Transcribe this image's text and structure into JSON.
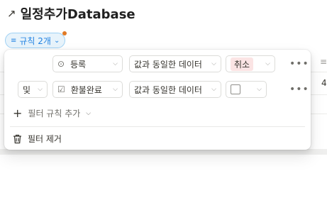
{
  "page": {
    "title": "일정추가Database",
    "title_icon": "arrow-up-right-icon"
  },
  "chip": {
    "label": "규칙 2개",
    "chevron": "⌄"
  },
  "background": {
    "cell_value": "4",
    "header_icon": "≡"
  },
  "filters": {
    "rules": [
      {
        "connector": "",
        "property_icon": "status-icon",
        "property": "등록",
        "operator": "값과 동일한 데이터",
        "value": "취소",
        "value_type": "tag"
      },
      {
        "connector": "및",
        "property_icon": "checkbox-icon",
        "property": "환불완료",
        "operator": "값과 동일한 데이터",
        "value": "",
        "value_type": "checkbox"
      }
    ],
    "add_label": "필터 규칙 추가",
    "remove_label": "필터 제거",
    "more_glyph": "•••"
  },
  "colors": {
    "chip_bg": "#e7f3fb",
    "chip_text": "#2383e2",
    "tag_bg": "#fbe4e4",
    "notification_dot": "#e07a26"
  }
}
